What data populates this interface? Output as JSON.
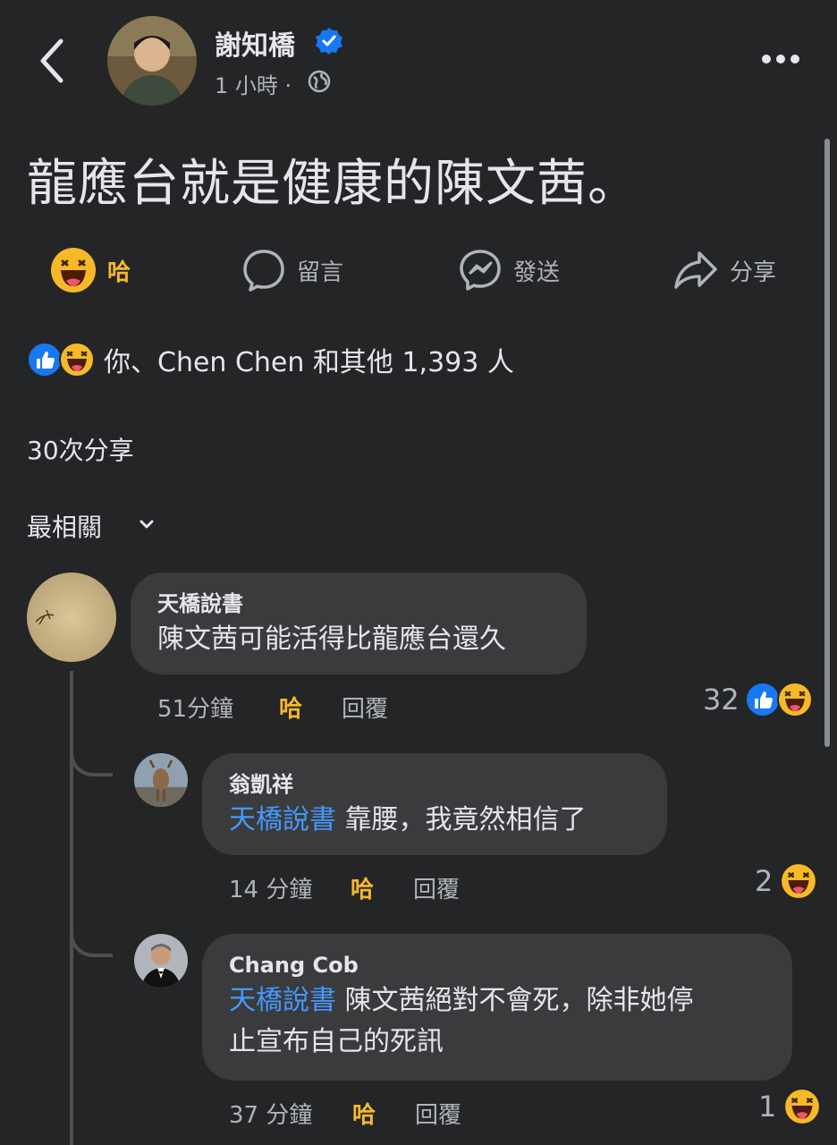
{
  "header": {
    "author_name": "謝知橋",
    "post_time": "1 小時 ·"
  },
  "post": {
    "text": "龍應台就是健康的陳文茜。"
  },
  "actions": {
    "react_label": "哈",
    "comment_label": "留言",
    "send_label": "發送",
    "share_label": "分享"
  },
  "reactions_summary": "你、Chen Chen 和其他 1,393 人",
  "shares_count": "30次分享",
  "sort_label": "最相關",
  "comments": [
    {
      "name": "天橋說書",
      "mention": "",
      "text": "陳文茜可能活得比龍應台還久",
      "time": "51分鐘",
      "react": "哈",
      "reply": "回覆",
      "count": "32"
    },
    {
      "name": "翁凱祥",
      "mention": "天橋說書",
      "text": "靠腰，我竟然相信了",
      "time": "14 分鐘",
      "react": "哈",
      "reply": "回覆",
      "count": "2"
    },
    {
      "name": "Chang Cob",
      "mention": "天橋說書",
      "text_line1": "陳文茜絕對不會死，除非她停",
      "text_line2": "止宣布自己的死訊",
      "time": "37 分鐘",
      "react": "哈",
      "reply": "回覆",
      "count": "1"
    }
  ],
  "colors": {
    "background": "#242526",
    "bubble": "#3a3b3c",
    "haha": "#f7b928",
    "like": "#1877f2",
    "mention": "#4599ff",
    "secondary_text": "#b0b3b8"
  },
  "icons": [
    "back-icon",
    "verified-badge-icon",
    "globe-icon",
    "more-icon",
    "haha-icon",
    "comment-icon",
    "messenger-icon",
    "share-icon",
    "like-icon",
    "chevron-down-icon"
  ]
}
